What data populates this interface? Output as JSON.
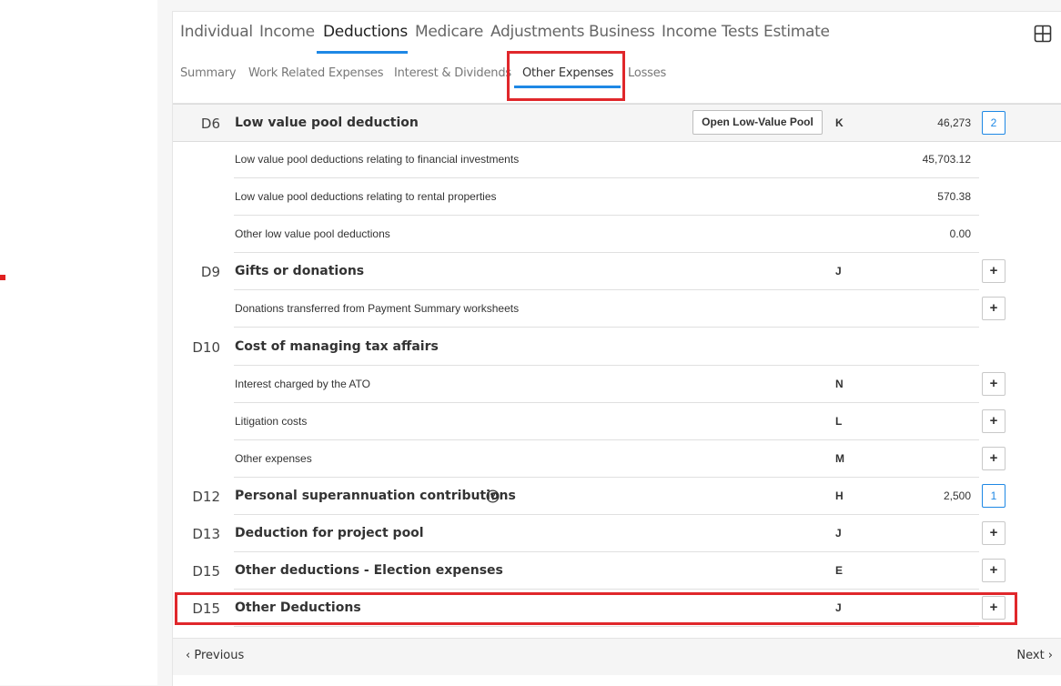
{
  "main_tabs": [
    {
      "label": "Individual"
    },
    {
      "label": "Income"
    },
    {
      "label": "Deductions"
    },
    {
      "label": "Medicare"
    },
    {
      "label": "Adjustments"
    },
    {
      "label": "Business"
    },
    {
      "label": "Income Tests"
    },
    {
      "label": "Estimate"
    }
  ],
  "main_active_tab": "Deductions",
  "sub_tabs": [
    {
      "label": "Summary"
    },
    {
      "label": "Work Related Expenses"
    },
    {
      "label": "Interest & Dividends"
    },
    {
      "label": "Other Expenses"
    },
    {
      "label": "Losses"
    }
  ],
  "sub_active_tab": "Other Expenses",
  "rows": {
    "d6": {
      "code": "D6",
      "label": "Low value pool deduction",
      "button": "Open Low-Value Pool",
      "letter": "K",
      "value": "46,273",
      "count": "2"
    },
    "d6_fin": {
      "label": "Low value pool deductions relating to financial investments",
      "value": "45,703.12"
    },
    "d6_rent": {
      "label": "Low value pool deductions relating to rental properties",
      "value": "570.38"
    },
    "d6_other": {
      "label": "Other low value pool deductions",
      "value": "0.00"
    },
    "d9": {
      "code": "D9",
      "label": "Gifts or donations",
      "letter": "J",
      "button": "+"
    },
    "d9_ps": {
      "label": "Donations transferred from Payment Summary worksheets",
      "button": "+"
    },
    "d10": {
      "code": "D10",
      "label": "Cost of managing tax affairs"
    },
    "d10_ato": {
      "label": "Interest charged by the ATO",
      "letter": "N",
      "button": "+"
    },
    "d10_lit": {
      "label": "Litigation costs",
      "letter": "L",
      "button": "+"
    },
    "d10_other": {
      "label": "Other expenses",
      "letter": "M",
      "button": "+"
    },
    "d12": {
      "code": "D12",
      "label": "Personal superannuation contributions",
      "letter": "H",
      "value": "2,500",
      "count": "1"
    },
    "d13": {
      "code": "D13",
      "label": "Deduction for project pool",
      "letter": "J",
      "button": "+"
    },
    "d15_election": {
      "code": "D15",
      "label": "Other deductions - Election expenses",
      "letter": "E",
      "button": "+"
    },
    "d15_other": {
      "code": "D15",
      "label": "Other Deductions",
      "letter": "J",
      "button": "+"
    }
  },
  "footer": {
    "previous": "‹ Previous",
    "next": "Next ›"
  },
  "colors": {
    "accent": "#1e88e5",
    "highlight": "#e0272b"
  }
}
